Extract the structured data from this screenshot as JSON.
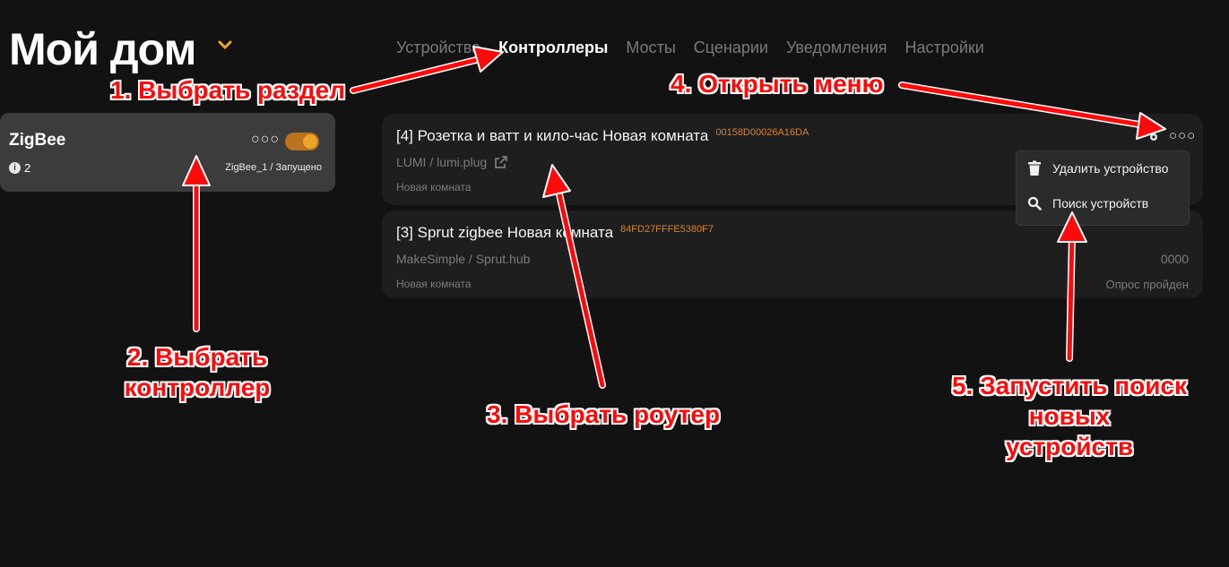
{
  "header": {
    "title": "Мой дом"
  },
  "nav": {
    "tabs": [
      {
        "label": "Устройства",
        "active": false
      },
      {
        "label": "Контроллеры",
        "active": true
      },
      {
        "label": "Мосты",
        "active": false
      },
      {
        "label": "Сценарии",
        "active": false
      },
      {
        "label": "Уведомления",
        "active": false
      },
      {
        "label": "Настройки",
        "active": false
      }
    ]
  },
  "controller": {
    "name": "ZigBee",
    "enabled": true,
    "info_count": "2",
    "status": "ZigBee_1 / Запущено"
  },
  "devices": [
    {
      "title": "[4] Розетка и ватт и кило-час Новая комната",
      "mac": "00158D00026A16DA",
      "model": "LUMI / lumi.plug",
      "room": "Новая комната"
    },
    {
      "title": "[3] Sprut zigbee Новая комната",
      "mac": "84FD27FFFE5380F7",
      "model": "MakeSimple / Sprut.hub",
      "room": "Новая комната",
      "code": "0000",
      "poll_status": "Опрос пройден"
    }
  ],
  "menu": {
    "items": [
      {
        "label": "Удалить устройство",
        "icon": "trash-icon"
      },
      {
        "label": "Поиск устройств",
        "icon": "search-icon"
      }
    ]
  },
  "annotations": {
    "a1": "1. Выбрать раздел",
    "a2_line1": "2. Выбрать",
    "a2_line2": "контроллер",
    "a3": "3. Выбрать роутер",
    "a4": "4. Открыть меню",
    "a5_line1": "5. Запустить поиск",
    "a5_line2": "новых",
    "a5_line3": "устройств"
  },
  "colors": {
    "accent": "#f0a32c",
    "mac": "#d9822b",
    "annotation": "#ff0a0a"
  }
}
